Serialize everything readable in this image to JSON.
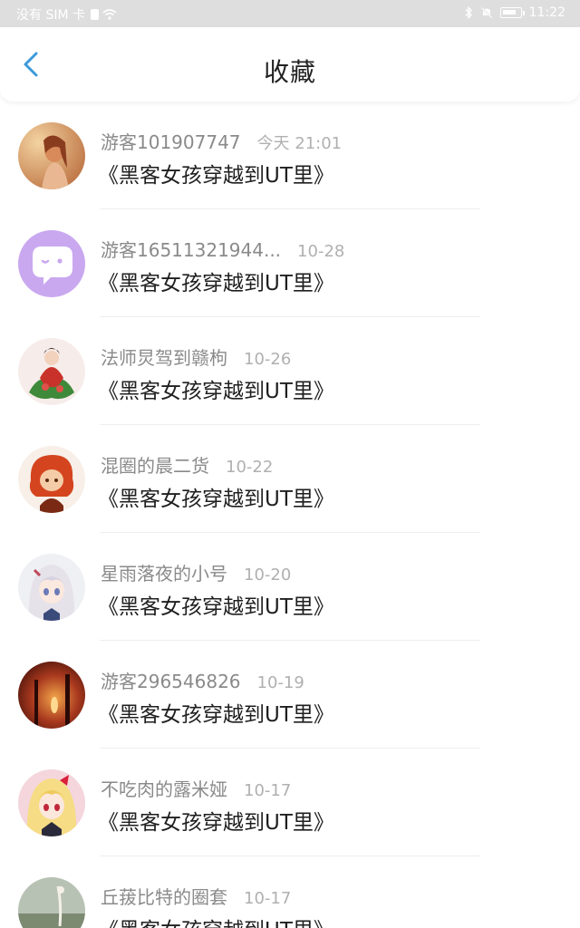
{
  "status_bar": {
    "carrier": "没有 SIM 卡",
    "time": "11:22"
  },
  "header": {
    "title": "收藏",
    "back_icon": "chevron-left-icon",
    "accent_color": "#3a9ad9"
  },
  "items": [
    {
      "username": "游客101907747",
      "date": "今天 21:01",
      "title": "《黑客女孩穿越到UT里》"
    },
    {
      "username": "游客16511321944...",
      "date": "10-28",
      "title": "《黑客女孩穿越到UT里》"
    },
    {
      "username": "法师炅驾到赣枸",
      "date": "10-26",
      "title": "《黑客女孩穿越到UT里》"
    },
    {
      "username": "混圈的晨二货",
      "date": "10-22",
      "title": "《黑客女孩穿越到UT里》"
    },
    {
      "username": "星雨落夜的小号",
      "date": "10-20",
      "title": "《黑客女孩穿越到UT里》"
    },
    {
      "username": "游客296546826",
      "date": "10-19",
      "title": "《黑客女孩穿越到UT里》"
    },
    {
      "username": "不吃肉的露米娅",
      "date": "10-17",
      "title": "《黑客女孩穿越到UT里》"
    },
    {
      "username": "丘菝比特的圈套",
      "date": "10-17",
      "title": "《黑客女孩穿越到UT里》"
    }
  ]
}
